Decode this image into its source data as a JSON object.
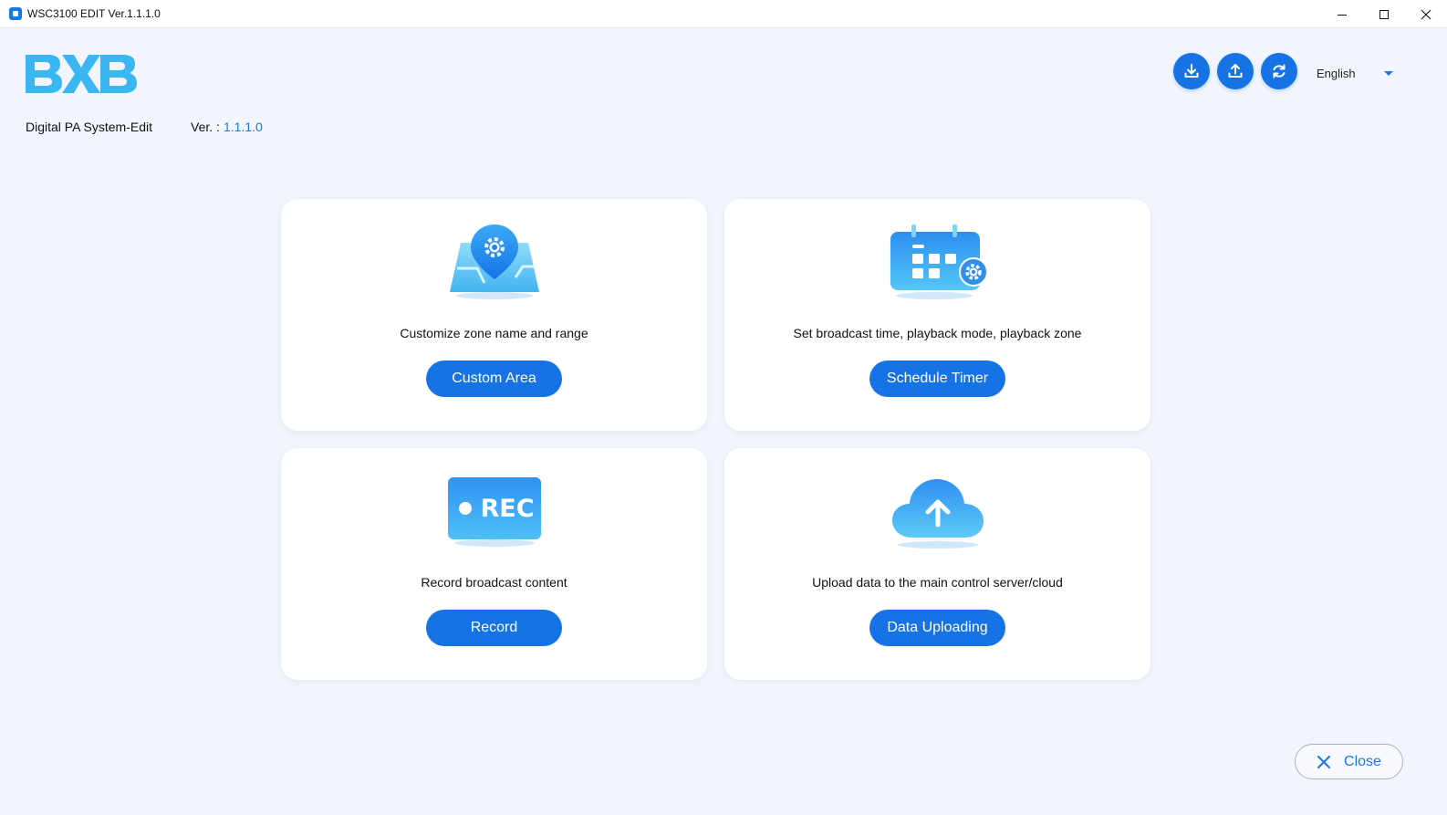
{
  "window": {
    "title": "WSC3100 EDIT Ver.1.1.1.0",
    "controls": [
      "minimize-icon",
      "maximize-icon",
      "close-icon"
    ]
  },
  "header": {
    "logo_text": "BXB",
    "app_name": "Digital PA System-Edit",
    "version_label": "Ver. :",
    "version_value": "1.1.1.0",
    "actions": [
      "download-icon",
      "upload-icon",
      "refresh-icon"
    ],
    "language": "English"
  },
  "cards": [
    {
      "icon": "map-location-gear-icon",
      "description": "Customize zone name and range",
      "button": "Custom Area"
    },
    {
      "icon": "calendar-gear-icon",
      "description": "Set broadcast time, playback mode, playback zone",
      "button": "Schedule Timer"
    },
    {
      "icon": "rec-icon",
      "icon_text": "REC",
      "description": "Record broadcast content",
      "button": "Record"
    },
    {
      "icon": "cloud-upload-icon",
      "description": "Upload data to the main control server/cloud",
      "button": "Data Uploading"
    }
  ],
  "footer": {
    "close_label": "Close"
  },
  "colors": {
    "accent": "#1673e6",
    "background": "#f2f6fc",
    "card": "#ffffff",
    "icon_light": "#4fc3f7"
  }
}
